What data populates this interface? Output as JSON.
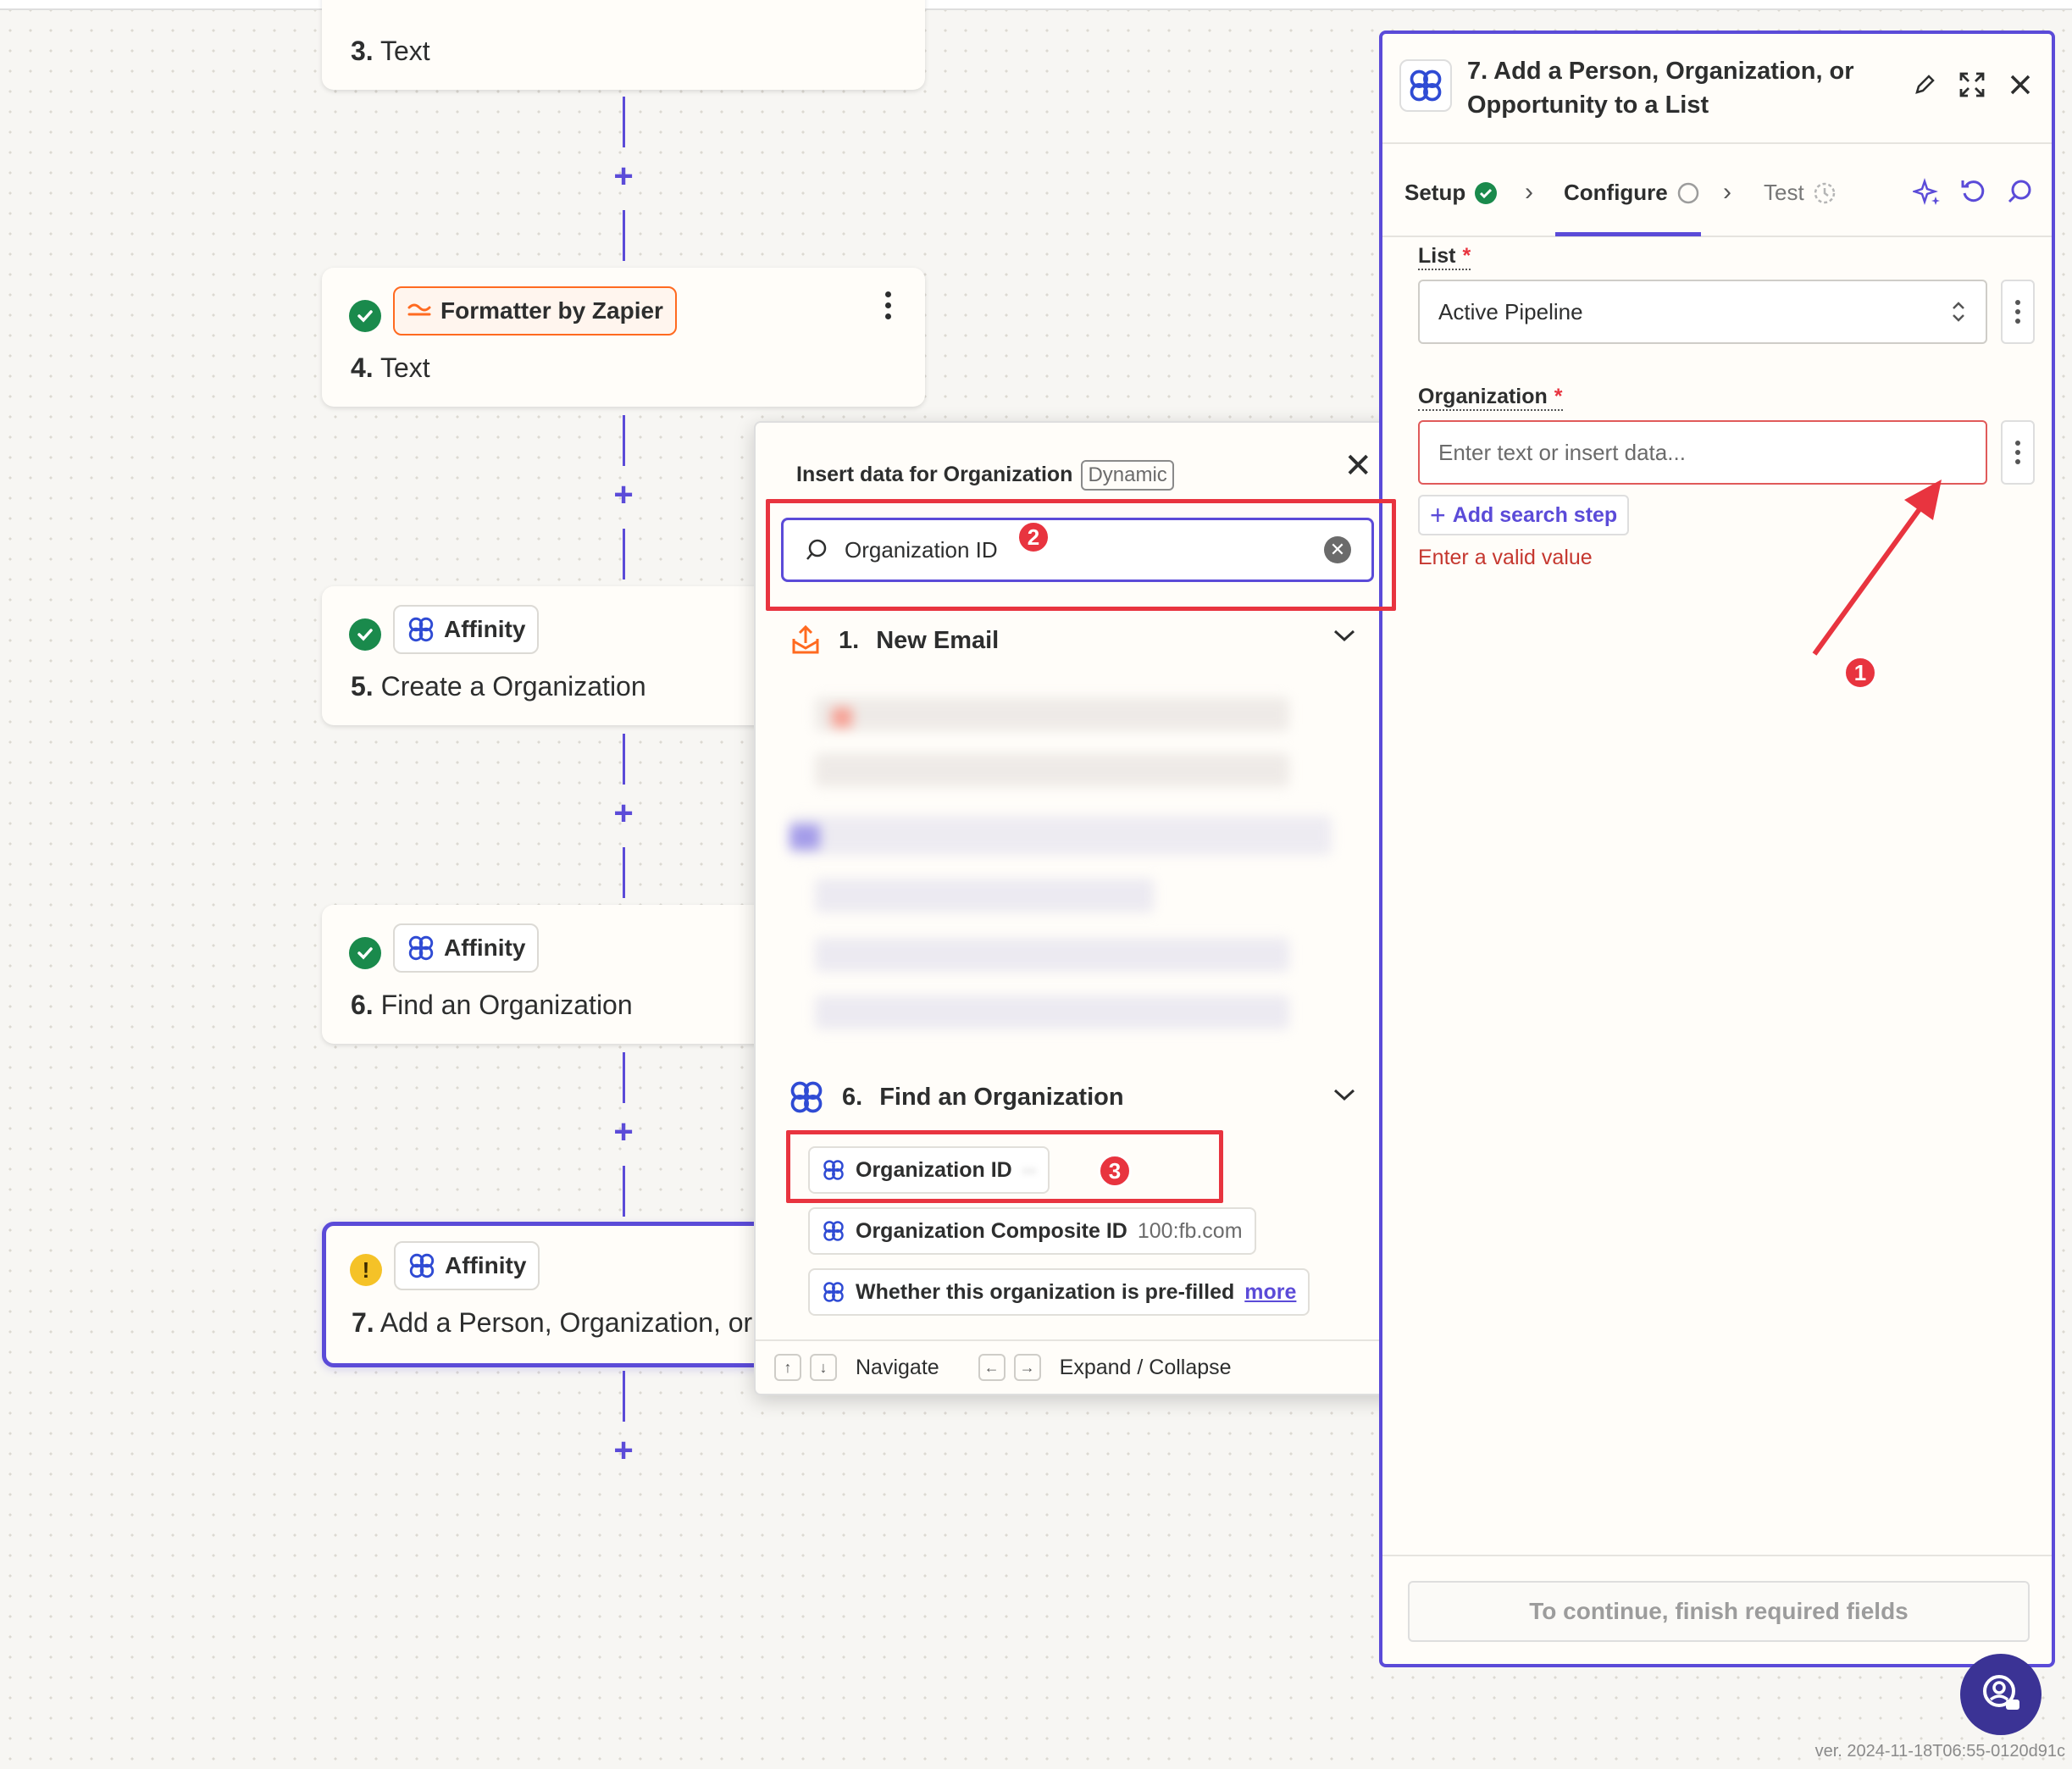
{
  "colors": {
    "accent": "#5b4bd8",
    "annotation": "#e8343f",
    "success": "#1a8a4c",
    "warning": "#f5c227",
    "formatter": "#ff6a20"
  },
  "steps": [
    {
      "number": "3.",
      "name": "Text",
      "app": "",
      "status": "none"
    },
    {
      "number": "4.",
      "name": "Text",
      "app": "Formatter by Zapier",
      "status": "success"
    },
    {
      "number": "5.",
      "name": "Create a Organization",
      "app": "Affinity",
      "status": "success"
    },
    {
      "number": "6.",
      "name": "Find an Organization",
      "app": "Affinity",
      "status": "success"
    },
    {
      "number": "7.",
      "name": "Add a Person, Organization, or",
      "app": "Affinity",
      "status": "warning"
    }
  ],
  "popup": {
    "title": "Insert data for Organization",
    "tag": "Dynamic",
    "search_value": "Organization ID",
    "sections": [
      {
        "number": "1.",
        "name": "New Email",
        "icon": "email-trigger-icon"
      },
      {
        "number": "6.",
        "name": "Find an Organization",
        "icon": "affinity-icon"
      }
    ],
    "fields": [
      {
        "label": "Organization ID",
        "value": ""
      },
      {
        "label": "Organization Composite ID",
        "value": "100:fb.com"
      },
      {
        "label": "Whether this organization is pre-filled",
        "value": "more"
      }
    ],
    "footer": {
      "navigate": "Navigate",
      "expand": "Expand / Collapse"
    }
  },
  "annotations": [
    "1",
    "2",
    "3"
  ],
  "panel": {
    "title": "7. Add a Person, Organization, or Opportunity to a List",
    "tabs": [
      {
        "label": "Setup",
        "state": "done"
      },
      {
        "label": "Configure",
        "state": "active"
      },
      {
        "label": "Test",
        "state": "pending"
      }
    ],
    "list_label": "List",
    "list_value": "Active Pipeline",
    "org_label": "Organization",
    "org_placeholder": "Enter text or insert data...",
    "add_search_step": "Add search step",
    "error": "Enter a valid value",
    "continue_button": "To continue, finish required fields",
    "required_mark": "*"
  },
  "version": "ver. 2024-11-18T06:55-0120d91c"
}
